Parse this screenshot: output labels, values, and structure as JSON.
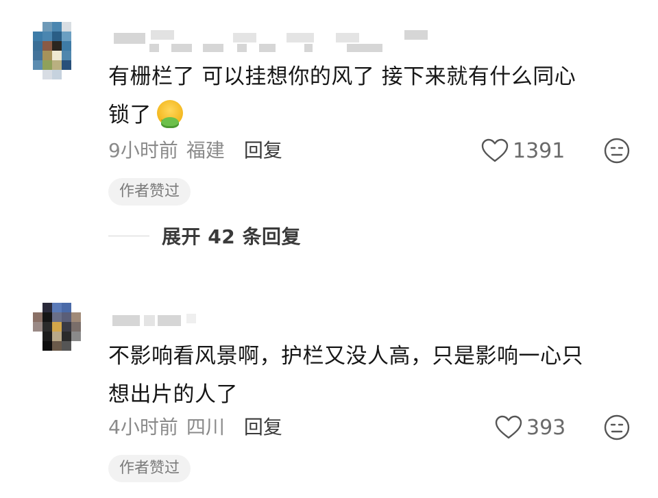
{
  "comments": [
    {
      "content_line1": "有栅栏了 可以挂想你的风了 接下来就有什么同心",
      "content_line2": "锁了",
      "emoji_icon": "nauseated-face",
      "time": "9小时前",
      "location": "福建",
      "reply_label": "回复",
      "like_count": "1391",
      "badge": "作者赞过",
      "expand_label": "展开 42 条回复"
    },
    {
      "content_line1": "不影响看风景啊，护栏又没人高，只是影响一心只",
      "content_line2": "想出片的人了",
      "time": "4小时前",
      "location": "四川",
      "reply_label": "回复",
      "like_count": "393",
      "badge": "作者赞过"
    }
  ],
  "colors": {
    "text_primary": "#161616",
    "text_meta": "#8a8a8a",
    "badge_bg": "#f2f2f2"
  }
}
